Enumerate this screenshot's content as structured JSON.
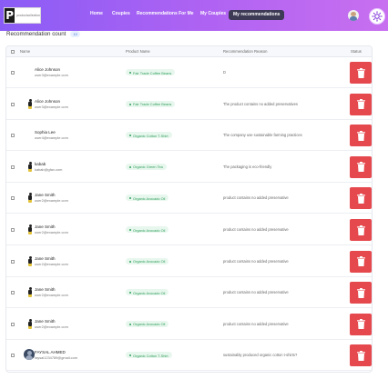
{
  "navbar": {
    "logo_letter": "P",
    "logo_text": "productcollection",
    "links": [
      {
        "label": "Home"
      },
      {
        "label": "Coupies"
      },
      {
        "label": "Recommendations For Me"
      },
      {
        "label": "My Coupies"
      },
      {
        "label": "My recommendations",
        "active": true
      }
    ]
  },
  "summary": {
    "label": "Recommendation count",
    "count": "10"
  },
  "table": {
    "headers": {
      "name": "Name",
      "product": "Product Name",
      "reason": "Recommendation Reason",
      "status": "Status"
    },
    "rows": [
      {
        "name": "Alice Johnson",
        "email": "user3@example.com",
        "product": "Fair Trade Coffee Beans",
        "reason": "D",
        "avatar": "none"
      },
      {
        "name": "Alice Johnson",
        "email": "user3@example.com",
        "product": "Fair Trade Coffee Beans",
        "reason": "The product contains no added preservatives",
        "avatar": "person-icon"
      },
      {
        "name": "Sophia Lee",
        "email": "user4@example.com",
        "product": "Organic Cotton T-Shirt",
        "reason": "The company use sustainable farming practices",
        "avatar": "none"
      },
      {
        "name": "kabab",
        "email": "kabab@gfax.com",
        "product": "Organic Green Tea",
        "reason": "The packaging is eco-friendly",
        "avatar": "person-icon"
      },
      {
        "name": "Jane Smith",
        "email": "user2@example.com",
        "product": "Organic Avocado Oil",
        "reason": "product contains no added preservative",
        "avatar": "person-icon"
      },
      {
        "name": "Jane Smith",
        "email": "user2@example.com",
        "product": "Organic Avocado Oil",
        "reason": "product contains no added preservative",
        "avatar": "person-icon"
      },
      {
        "name": "Jane Smith",
        "email": "user2@example.com",
        "product": "Organic Avocado Oil",
        "reason": "product contains no added preservative",
        "avatar": "person-icon"
      },
      {
        "name": "Jane Smith",
        "email": "user2@example.com",
        "product": "Organic Avocado Oil",
        "reason": "product contains no added preservative",
        "avatar": "person-icon"
      },
      {
        "name": "Jane Smith",
        "email": "user2@example.com",
        "product": "Organic Avocado Oil",
        "reason": "product contains no added preservative",
        "avatar": "person-icon"
      },
      {
        "name": "FAYSAL AHMED",
        "email": "faysal1234789@gmail.com",
        "product": "Organic Cotton T-Shirt",
        "reason": "sustainably produced organic cotton t-shirts?",
        "avatar": "photo"
      }
    ]
  },
  "colors": {
    "nav_gradient_start": "#8a5cf6",
    "nav_gradient_end": "#c86ff0",
    "active_link_bg": "#3d3a55",
    "delete_button": "#e5484d",
    "product_badge_bg": "#e8f7ee",
    "product_badge_text": "#2f9e5b"
  },
  "icons": {
    "theme_toggle": "sun-icon",
    "delete": "trash-icon",
    "user": "avatar"
  }
}
